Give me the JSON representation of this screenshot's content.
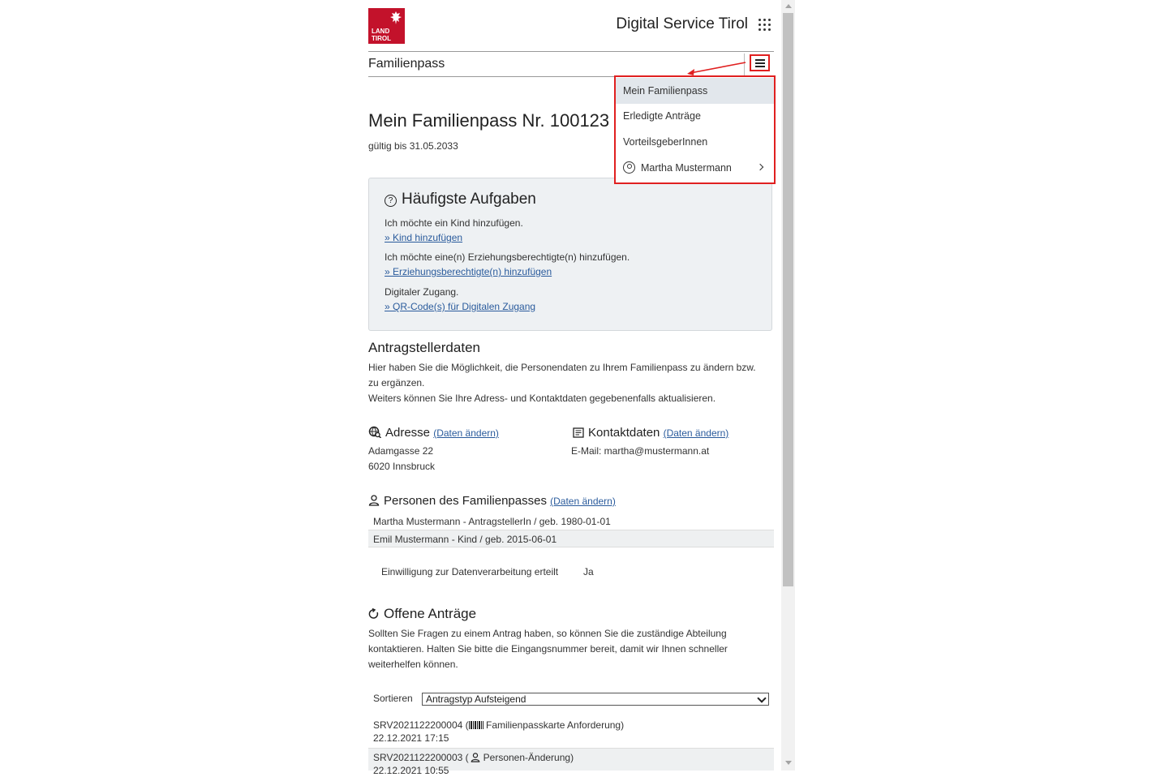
{
  "header": {
    "logo_text": "LAND TIROL",
    "brand": "Digital Service Tirol",
    "subtitle": "Familienpass"
  },
  "main": {
    "title": "Mein Familienpass Nr. 100123",
    "valid": "gültig bis 31.05.2033"
  },
  "tasks": {
    "title": "Häufigste Aufgaben",
    "items": [
      {
        "text": "Ich möchte ein Kind hinzufügen.",
        "link": "» Kind hinzufügen"
      },
      {
        "text": "Ich möchte eine(n) Erziehungsberechtigte(n) hinzufügen.",
        "link": "» Erziehungsberechtigte(n) hinzufügen"
      },
      {
        "text": "Digitaler Zugang.",
        "link": "» QR-Code(s) für Digitalen Zugang"
      }
    ]
  },
  "applicant": {
    "title": "Antragstellerdaten",
    "line1": "Hier haben Sie die Möglichkeit, die Personendaten zu Ihrem Familienpass zu ändern bzw.",
    "line2": "zu ergänzen.",
    "line3": "Weiters können Sie Ihre Adress- und Kontaktdaten gegebenenfalls aktualisieren."
  },
  "address": {
    "title": "Adresse",
    "change": "(Daten ändern)",
    "street": "Adamgasse 22",
    "city": "6020 Innsbruck"
  },
  "contact": {
    "title": "Kontaktdaten",
    "change": "(Daten ändern)",
    "email": "E-Mail: martha@mustermann.at"
  },
  "persons": {
    "title": "Personen des Familienpasses",
    "change": "(Daten ändern)",
    "rows": [
      "Martha Mustermann - AntragstellerIn / geb. 1980-01-01",
      "Emil Mustermann - Kind / geb. 2015-06-01"
    ],
    "consent_label": "Einwilligung zur Datenverarbeitung erteilt",
    "consent_value": "Ja"
  },
  "open": {
    "title": "Offene Anträge",
    "line1": "Sollten Sie Fragen zu einem Antrag haben, so können Sie die zuständige Abteilung",
    "line2": "kontaktieren. Halten Sie bitte die Eingangsnummer bereit, damit wir Ihnen schneller",
    "line3": "weiterhelfen können.",
    "sort_label": "Sortieren",
    "sort_value": "Antragstyp Aufsteigend",
    "apps": [
      {
        "id": "SRV2021122200004 (",
        "type": "Familienpasskarte Anforderung)",
        "date": "22.12.2021 17:15"
      },
      {
        "id": "SRV2021122200003 (",
        "type": "Personen-Änderung)",
        "date": "22.12.2021 10:55"
      }
    ]
  },
  "menu": {
    "items": [
      "Mein Familienpass",
      "Erledigte Anträge",
      "VorteilsgeberInnen"
    ],
    "user": "Martha Mustermann"
  },
  "colors": {
    "brand_red": "#c3122b",
    "highlight": "#e02020",
    "link": "#2a5b9c",
    "box_bg": "#eef1f3"
  }
}
